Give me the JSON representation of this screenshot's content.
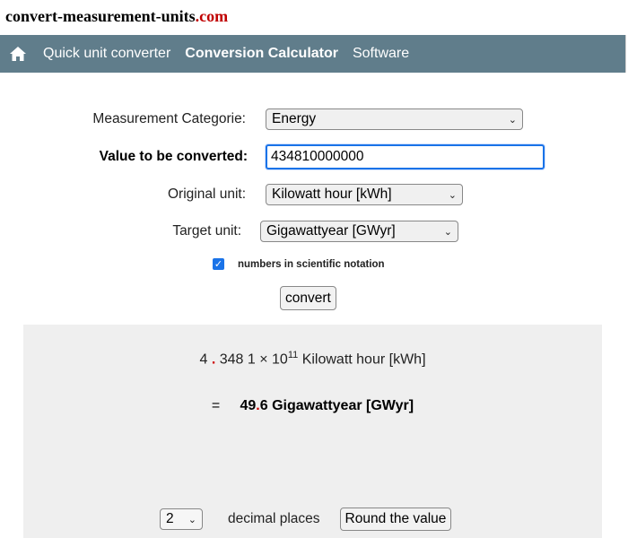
{
  "site": {
    "logo_name": "convert-measurement-units",
    "logo_tld": ".com"
  },
  "nav": {
    "items": [
      {
        "label": "Quick unit converter",
        "active": false
      },
      {
        "label": "Conversion Calculator",
        "active": true
      },
      {
        "label": "Software",
        "active": false
      }
    ]
  },
  "form": {
    "category_label": "Measurement Categorie:",
    "category_value": "Energy",
    "value_label": "Value to be converted:",
    "value": "434810000000",
    "original_label": "Original unit:",
    "original_value": "Kilowatt hour [kWh]",
    "target_label": "Target unit:",
    "target_value": "Gigawattyear [GWyr]",
    "scientific_label": "numbers in scientific notation",
    "scientific_checked": true,
    "convert_label": "convert"
  },
  "result": {
    "input_int": "4",
    "input_frac": "348 1 × 10",
    "input_exp": "11",
    "input_unit": "Kilowatt hour [kWh]",
    "equals": "=",
    "output_int": "49",
    "output_frac": "6 Gigawattyear [GWyr]"
  },
  "rounding": {
    "decimal_value": "2",
    "decimal_label": "decimal places",
    "round_label": "Round the value"
  },
  "colors": {
    "nav_bg": "#607d8b",
    "accent": "#1a73e8",
    "logo_tld": "#c00000"
  }
}
